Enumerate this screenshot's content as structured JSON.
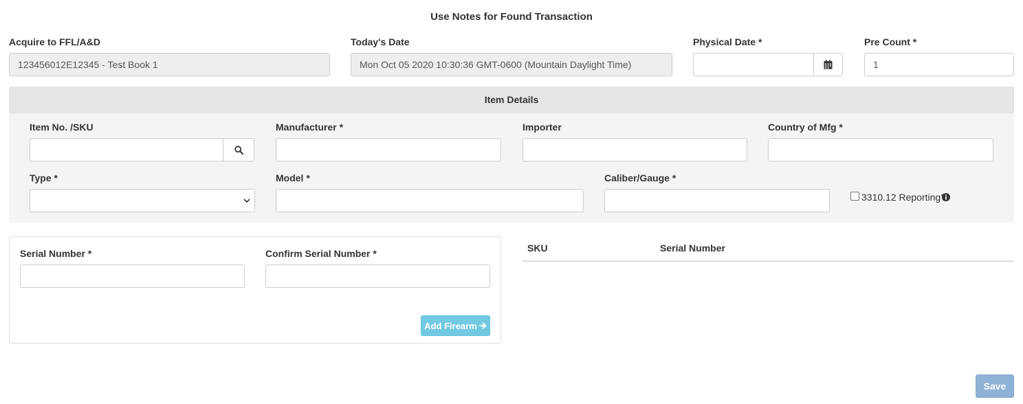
{
  "page": {
    "title": "Use Notes for Found Transaction"
  },
  "header_fields": {
    "acquire": {
      "label": "Acquire to FFL/A&D",
      "value": "123456012E12345 - Test Book 1"
    },
    "todays_date": {
      "label": "Today's Date",
      "value": "Mon Oct 05 2020 10:30:36 GMT-0600 (Mountain Daylight Time)"
    },
    "physical_date": {
      "label": "Physical Date *",
      "value": "",
      "icon": "calendar-icon"
    },
    "pre_count": {
      "label": "Pre Count *",
      "value": "1"
    }
  },
  "item_details": {
    "header": "Item Details",
    "sku": {
      "label": "Item No. /SKU",
      "value": "",
      "icon": "search-icon"
    },
    "manufacturer": {
      "label": "Manufacturer *",
      "value": ""
    },
    "importer": {
      "label": "Importer",
      "value": ""
    },
    "country": {
      "label": "Country of Mfg *",
      "value": ""
    },
    "type": {
      "label": "Type *",
      "value": ""
    },
    "model": {
      "label": "Model *",
      "value": ""
    },
    "caliber": {
      "label": "Caliber/Gauge *",
      "value": ""
    },
    "reporting": {
      "label": "3310.12 Reporting?",
      "checked": false,
      "icon": "info-circle-icon"
    }
  },
  "serial_panel": {
    "serial": {
      "label": "Serial Number *",
      "value": ""
    },
    "confirm_serial": {
      "label": "Confirm Serial Number *",
      "value": ""
    },
    "add_button": {
      "label": "Add Firearm",
      "icon": "arrow-right-icon"
    }
  },
  "added_table": {
    "columns": [
      "SKU",
      "Serial Number"
    ],
    "rows": []
  },
  "footer": {
    "save_label": "Save"
  },
  "colors": {
    "info_button": "#5bc0de",
    "primary_disabled": "#8fb3d6",
    "section_bg": "#f4f4f4",
    "section_header_bg": "#e6e6e6"
  }
}
